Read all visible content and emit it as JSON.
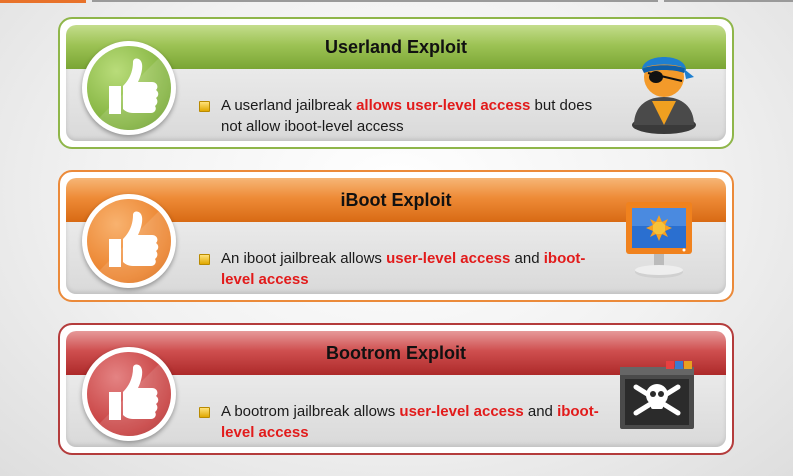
{
  "cards": [
    {
      "title": "Userland Exploit",
      "line": {
        "a": "A userland jailbreak ",
        "b": "allows user-level access",
        "c": " but does not allow iboot-level access"
      },
      "icon": "pirate-user-icon",
      "color": "#8fb64a"
    },
    {
      "title": "iBoot Exploit",
      "line": {
        "a": "An iboot jailbreak allows ",
        "b": "user-level access",
        "c": " and ",
        "d": "iboot-level access"
      },
      "icon": "computer-monitor-icon",
      "color": "#eb8a3a"
    },
    {
      "title": "Bootrom Exploit",
      "line": {
        "a": "A bootrom jailbreak allows ",
        "b": "user-level access",
        "c": " and ",
        "d": "iboot-level access"
      },
      "icon": "skull-crossbones-window-icon",
      "color": "#b43c3c"
    }
  ],
  "badge_icon": "thumbs-up-icon"
}
